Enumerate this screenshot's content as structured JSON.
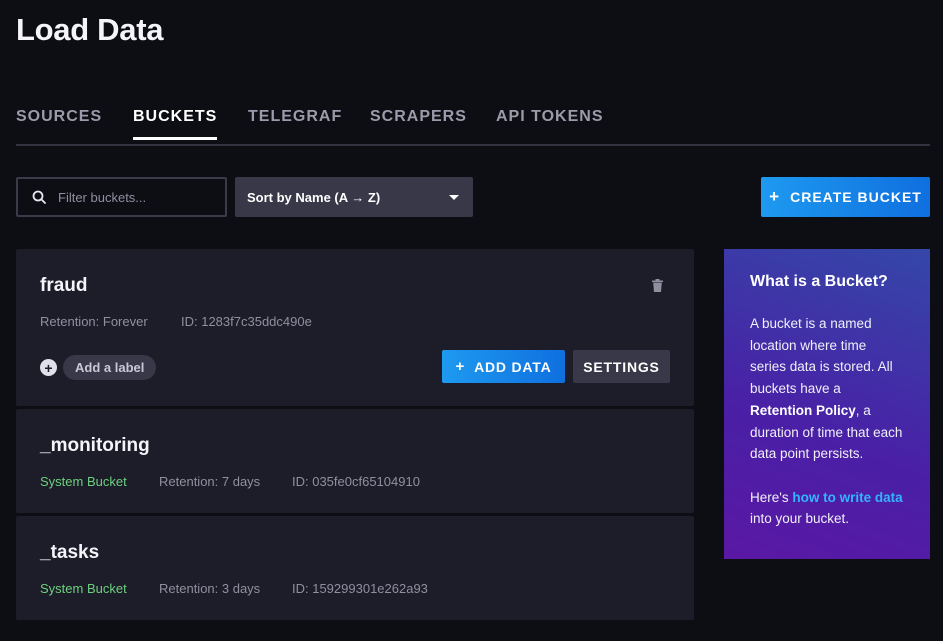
{
  "page": {
    "title": "Load Data"
  },
  "tabs": [
    {
      "label": "SOURCES",
      "active": false
    },
    {
      "label": "BUCKETS",
      "active": true
    },
    {
      "label": "TELEGRAF",
      "active": false
    },
    {
      "label": "SCRAPERS",
      "active": false
    },
    {
      "label": "API TOKENS",
      "active": false
    }
  ],
  "toolbar": {
    "filter_placeholder": "Filter buckets...",
    "sort_label": "Sort by Name (A → Z)",
    "create_plus": "+",
    "create_label": "CREATE BUCKET"
  },
  "buckets": [
    {
      "name": "fraud",
      "retention": "Retention: Forever",
      "id": "ID: 1283f7c35ddc490e",
      "add_label": "Add a label",
      "add_label_plus": "+",
      "add_data_plus": "+",
      "add_data_label": "ADD DATA",
      "settings_label": "SETTINGS"
    },
    {
      "name": "_monitoring",
      "type": "System Bucket",
      "retention": "Retention: 7 days",
      "id": "ID: 035fe0cf65104910"
    },
    {
      "name": "_tasks",
      "type": "System Bucket",
      "retention": "Retention: 3 days",
      "id": "ID: 159299301e262a93"
    }
  ],
  "info": {
    "title": "What is a Bucket?",
    "p1_a": "A bucket is a named location where time series data is stored. All buckets have a ",
    "p1_bold": "Retention Policy",
    "p1_b": ", a duration of time that each data point persists.",
    "p2_a": "Here's ",
    "p2_link": "how to write data",
    "p2_b": " into your bucket."
  },
  "colors": {
    "accent": "#1e9af0",
    "system_bucket": "#6cd07f",
    "card_bg": "#1d1d29",
    "page_bg": "#0d0d14"
  }
}
